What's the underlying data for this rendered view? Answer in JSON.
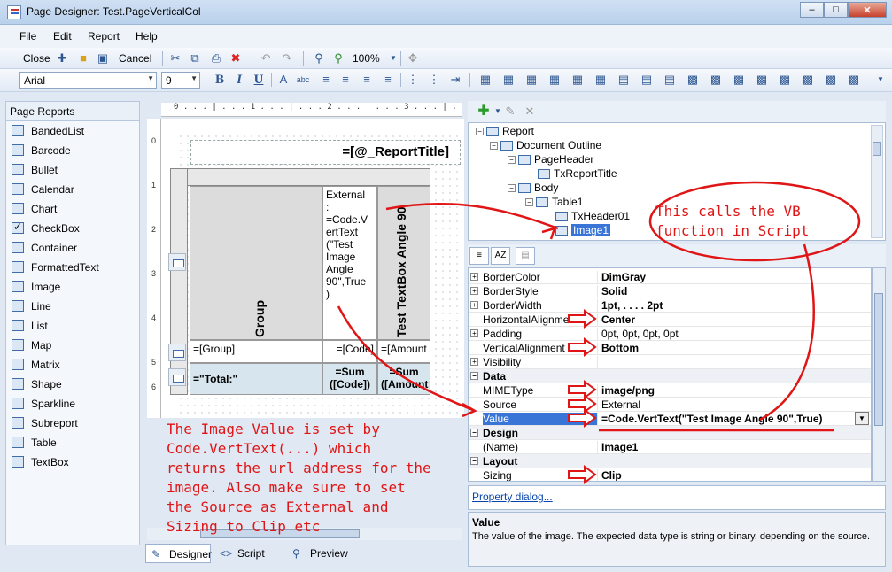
{
  "window": {
    "title": "Page Designer: Test.PageVerticalCol"
  },
  "menu": [
    "File",
    "Edit",
    "Report",
    "Help"
  ],
  "toolbar1": {
    "close_label": "Close",
    "cancel_label": "Cancel",
    "zoom": "100%"
  },
  "toolbar2": {
    "font": "Arial",
    "size": "9",
    "bold": "B",
    "italic": "I",
    "underline": "U"
  },
  "left_panel": {
    "header": "Page Reports",
    "items": [
      "BandedList",
      "Barcode",
      "Bullet",
      "Calendar",
      "Chart",
      "CheckBox",
      "Container",
      "FormattedText",
      "Image",
      "Line",
      "List",
      "Map",
      "Matrix",
      "Shape",
      "Sparkline",
      "Subreport",
      "Table",
      "TextBox"
    ]
  },
  "designer": {
    "report_title": "=[@_ReportTitle]",
    "ruler_v": [
      "0",
      "1",
      "2",
      "3",
      "4",
      "5",
      "6"
    ],
    "group_header": "Group",
    "image_cell": "External\n:\n=Code.V\nertText\n(\"Test\nImage\nAngle\n90\",True\n)",
    "vert_header": "Test TextBox Angle 90",
    "row_group": "=[Group]",
    "row_code": "=[Code]",
    "row_amount": "=[Amount",
    "total_label": "=\"Total:\"",
    "total_code": "=Sum\n([Code])",
    "total_amount": "=Sum\n([Amount"
  },
  "tree": {
    "nodes": [
      {
        "label": "Report"
      },
      {
        "label": "Document Outline"
      },
      {
        "label": "PageHeader"
      },
      {
        "label": "TxReportTitle"
      },
      {
        "label": "Body"
      },
      {
        "label": "Table1"
      },
      {
        "label": "TxHeader01"
      },
      {
        "label": "Image1"
      }
    ]
  },
  "properties": [
    {
      "name": "BorderColor",
      "value": "DimGray",
      "expand": true
    },
    {
      "name": "BorderStyle",
      "value": "Solid",
      "expand": true
    },
    {
      "name": "BorderWidth",
      "value": "1pt, . . . . 2pt",
      "expand": true
    },
    {
      "name": "HorizontalAlignment",
      "value": "Center"
    },
    {
      "name": "Padding",
      "value": "0pt, 0pt, 0pt, 0pt",
      "expand": true
    },
    {
      "name": "VerticalAlignment",
      "value": "Bottom"
    },
    {
      "name": "Visibility",
      "value": "",
      "expand": true
    },
    {
      "category": "Data"
    },
    {
      "name": "MIMEType",
      "value": "image/png"
    },
    {
      "name": "Source",
      "value": "External"
    },
    {
      "name": "Value",
      "value": "=Code.VertText(\"Test Image Angle 90\",True)"
    },
    {
      "category": "Design"
    },
    {
      "name": "(Name)",
      "value": "Image1"
    },
    {
      "category": "Layout"
    },
    {
      "name": "Sizing",
      "value": "Clip"
    }
  ],
  "property_dialog_link": "Property dialog...",
  "description": {
    "title": "Value",
    "text": "The value of the image.  The expected data type is string or binary, depending on the source."
  },
  "bottom_tabs": [
    "Designer",
    "Script",
    "Preview"
  ],
  "annotations": {
    "left": "The Image Value is set by\nCode.VertText(...) which\nreturns the url address for the\nimage. Also make sure to set\nthe Source as External and\nSizing to Clip etc",
    "right": "This calls the VB\nfunction in Script"
  },
  "colors": {
    "annotation": "#e01515",
    "selection": "#3875d7"
  }
}
